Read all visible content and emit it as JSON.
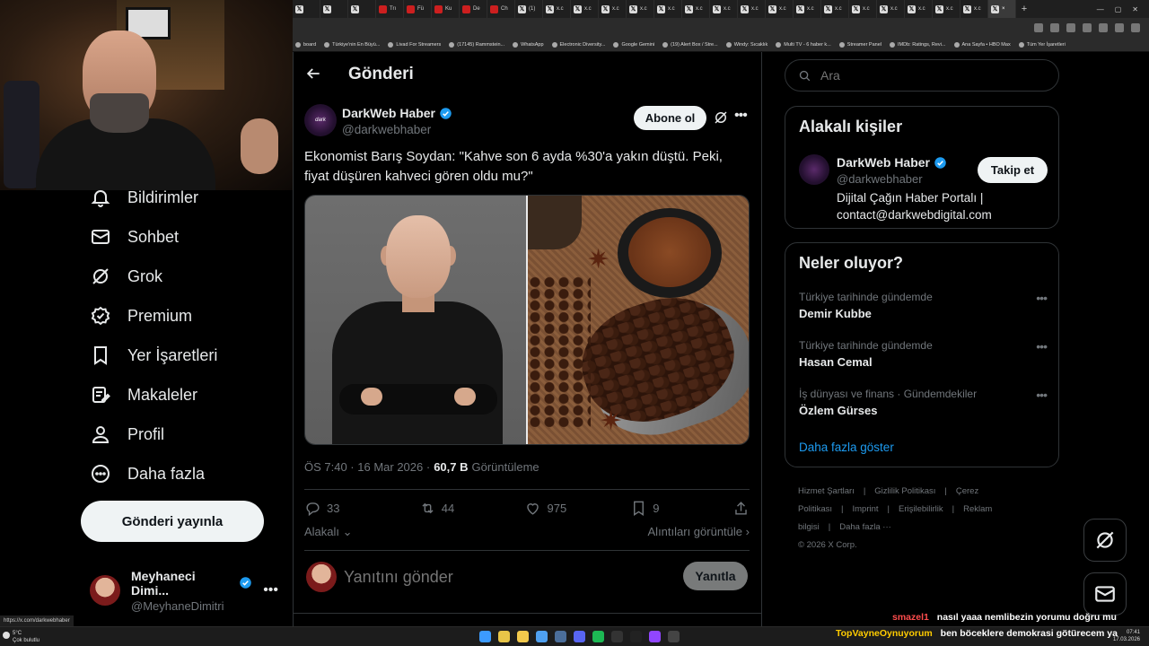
{
  "browser": {
    "tabs": [
      {
        "label": "",
        "icon": "x"
      },
      {
        "label": "",
        "icon": "x"
      },
      {
        "label": "",
        "icon": "x"
      },
      {
        "label": "Trı",
        "icon": "red"
      },
      {
        "label": "Fü",
        "icon": "red"
      },
      {
        "label": "Ku",
        "icon": "red"
      },
      {
        "label": "De",
        "icon": "red"
      },
      {
        "label": "Ch",
        "icon": "red"
      },
      {
        "label": "(1)",
        "icon": "x"
      },
      {
        "label": "x.c",
        "icon": "x"
      },
      {
        "label": "x.c",
        "icon": "x"
      },
      {
        "label": "x.c",
        "icon": "x"
      },
      {
        "label": "x.c",
        "icon": "x"
      },
      {
        "label": "x.c",
        "icon": "x"
      },
      {
        "label": "x.c",
        "icon": "x"
      },
      {
        "label": "x.c",
        "icon": "x"
      },
      {
        "label": "x.c",
        "icon": "x"
      },
      {
        "label": "x.c",
        "icon": "x"
      },
      {
        "label": "x.c",
        "icon": "x"
      },
      {
        "label": "x.c",
        "icon": "x"
      },
      {
        "label": "x.c",
        "icon": "x"
      },
      {
        "label": "x.c",
        "icon": "x"
      },
      {
        "label": "x.c",
        "icon": "x"
      },
      {
        "label": "x.c",
        "icon": "x"
      },
      {
        "label": "x.c",
        "icon": "x"
      }
    ],
    "active_tab_close": "×",
    "new_tab": "+",
    "bookmarks": [
      "board",
      "Türkiye'nin En Büyü...",
      "Livad For Streamers",
      "(17145) Rammstein...",
      "WhatsApp",
      "Electronic Diversity...",
      "Google Gemini",
      "(19) Alert Box / Stre...",
      "Windy: Sıcaklık",
      "Multi TV - 6 haber k...",
      "Streamer Panel",
      "IMDb: Ratings, Revi...",
      "Ana Sayfa • HBO Max"
    ],
    "bookmarks_overflow": "»",
    "bookmarks_all": "Tüm Yer İşaretleri",
    "status_url": "https://x.com/darkwebhaber"
  },
  "sidebar": {
    "items": [
      {
        "label": "Bildirimler",
        "icon": "bell-icon"
      },
      {
        "label": "Sohbet",
        "icon": "mail-icon"
      },
      {
        "label": "Grok",
        "icon": "grok-icon"
      },
      {
        "label": "Premium",
        "icon": "premium-icon"
      },
      {
        "label": "Yer İşaretleri",
        "icon": "bookmark-icon"
      },
      {
        "label": "Makaleler",
        "icon": "article-icon"
      },
      {
        "label": "Profil",
        "icon": "profile-icon"
      },
      {
        "label": "Daha fazla",
        "icon": "more-circle-icon"
      }
    ],
    "post_button": "Gönderi yayınla",
    "account": {
      "name": "Meyhaneci Dimi...",
      "handle": "@MeyhaneDimitri",
      "more": "•••"
    }
  },
  "main": {
    "header_title": "Gönderi",
    "author": {
      "name": "DarkWeb Haber",
      "handle": "@darkwebhaber",
      "avatar_text": "dark"
    },
    "subscribe_button": "Abone ol",
    "more": "•••",
    "text": "Ekonomist Barış Soydan: \"Kahve son 6 ayda %30'a yakın düştü. Peki, fiyat düşüren kahveci gören oldu mu?\"",
    "meta": {
      "time": "ÖS 7:40 · 16 Mar 2026 ·",
      "views": "60,7 B",
      "views_label": "Görüntüleme"
    },
    "actions": {
      "replies": "33",
      "reposts": "44",
      "likes": "975",
      "bookmarks": "9"
    },
    "related": "Alakalı",
    "quotes": "Alıntıları görüntüle",
    "reply_placeholder": "Yanıtını gönder",
    "reply_button": "Yanıtla"
  },
  "right": {
    "search_placeholder": "Ara",
    "related_people": {
      "title": "Alakalı kişiler",
      "name": "DarkWeb Haber",
      "handle": "@darkwebhaber",
      "bio": "Dijital Çağın Haber Portalı | contact@darkwebdigital.com",
      "follow_button": "Takip et"
    },
    "trends": {
      "title": "Neler oluyor?",
      "items": [
        {
          "context": "Türkiye tarihinde gündemde",
          "name": "Demir Kubbe"
        },
        {
          "context": "Türkiye tarihinde gündemde",
          "name": "Hasan Cemal"
        },
        {
          "context": "İş dünyası ve finans · Gündemdekiler",
          "name": "Özlem Gürses"
        }
      ],
      "more": "•••",
      "show_more": "Daha fazla göster"
    },
    "footer": {
      "links": [
        "Hizmet Şartları",
        "|",
        "Gizlilik Politikası",
        "|",
        "Çerez Politikası",
        "|",
        "Imprint",
        "|",
        "Erişilebilirlik",
        "|",
        "Reklam bilgisi",
        "|",
        "Daha fazla ···"
      ],
      "copyright": "© 2026 X Corp."
    }
  },
  "chat": [
    {
      "user": "smazel1",
      "message": "nasıl yaaa nemlibezin yorumu doğru mu",
      "user_color": "#ff4d4d"
    },
    {
      "user": "TopVayneOynuyorum",
      "message": "ben böceklere demokrasi götürecem ya",
      "user_color": "#ffcc00"
    }
  ],
  "taskbar": {
    "weather_temp": "5°C",
    "weather_desc": "Çok bulutlu",
    "time": "07:41",
    "date": "17.03.2026"
  },
  "colors": {
    "accent": "#1d9bf0",
    "verified": "#1d9bf0"
  }
}
